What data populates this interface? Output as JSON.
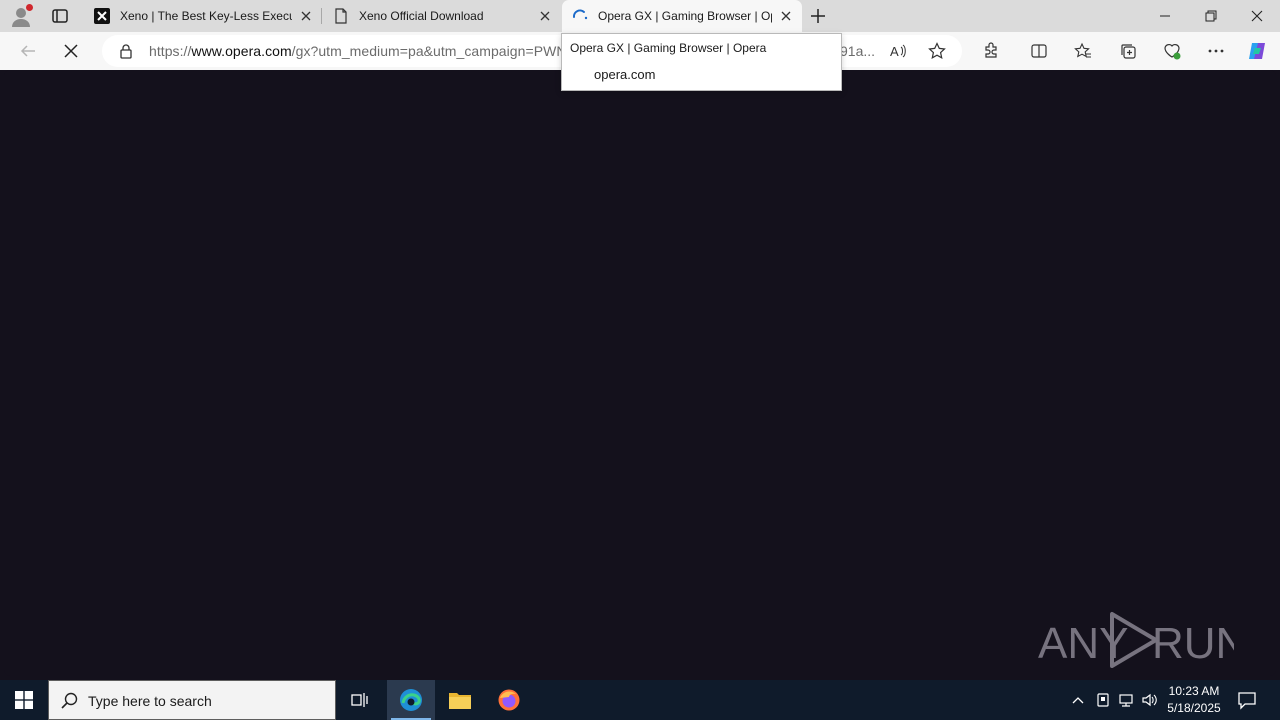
{
  "browser": {
    "tabs": [
      {
        "title": "Xeno | The Best Key-Less Executor",
        "favicon": "xeno-favicon"
      },
      {
        "title": "Xeno Official Download",
        "favicon": "page-icon"
      },
      {
        "title": "Opera GX | Gaming Browser | Opera",
        "favicon": "loading-spinner-icon",
        "active": true
      }
    ],
    "address": {
      "scheme": "https://",
      "host": "www.opera.com",
      "path": "/gx?utm_medium=pa&utm_campaign=PWN",
      "tail": "91a..."
    },
    "tooltip": {
      "title": "Opera GX | Gaming Browser | Opera",
      "domain": "opera.com"
    }
  },
  "watermark": {
    "text": "ANY RUN"
  },
  "taskbar": {
    "search_placeholder": "Type here to search",
    "time": "10:23 AM",
    "date": "5/18/2025"
  },
  "colors": {
    "page_background": "#14111c",
    "tabstrip": "#dbdbdb",
    "taskbar": "#0f1b2b"
  }
}
